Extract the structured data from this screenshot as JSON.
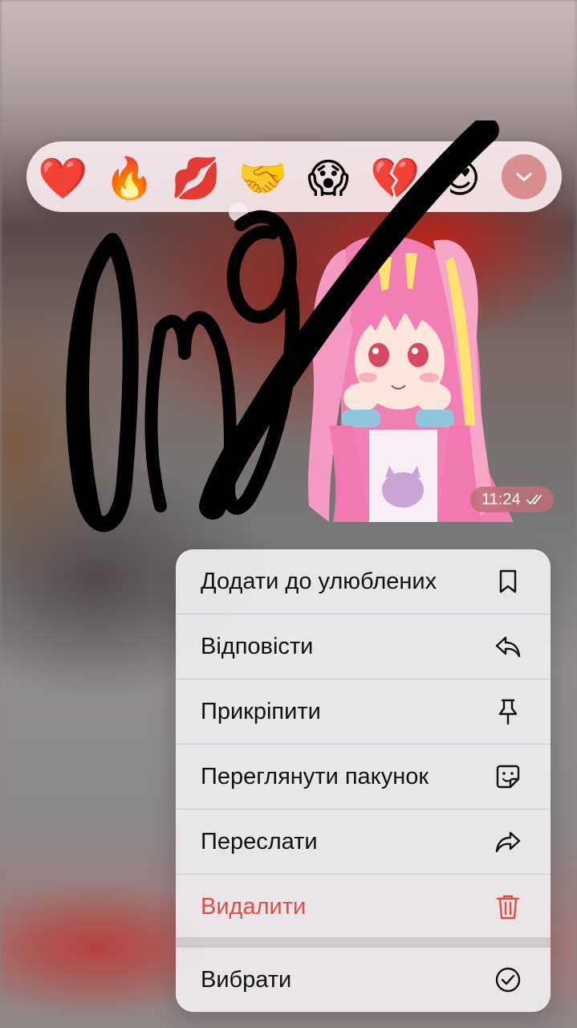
{
  "reactions": [
    {
      "emoji": "❤️",
      "name": "red-heart"
    },
    {
      "emoji": "🔥",
      "name": "fire"
    },
    {
      "emoji": "💋",
      "name": "kiss-mark"
    },
    {
      "emoji": "🤝",
      "name": "handshake"
    },
    {
      "emoji": "😱",
      "name": "scream"
    },
    {
      "emoji": "💔",
      "name": "broken-heart"
    },
    {
      "emoji": "😍",
      "name": "heart-eyes"
    }
  ],
  "message": {
    "time": "11:24",
    "status_icon": "double-check-icon"
  },
  "menu": {
    "items": [
      {
        "label": "Додати до улюблених",
        "icon": "bookmark-icon"
      },
      {
        "label": "Відповісти",
        "icon": "reply-icon"
      },
      {
        "label": "Прикріпити",
        "icon": "pin-icon"
      },
      {
        "label": "Переглянути пакунок",
        "icon": "sticker-pack-icon"
      },
      {
        "label": "Переслати",
        "icon": "forward-icon"
      },
      {
        "label": "Видалити",
        "icon": "trash-icon"
      },
      {
        "label": "Вибрати",
        "icon": "check-circle-icon"
      }
    ]
  },
  "colors": {
    "danger": "#e64c43",
    "reaction_bar": "#f8ecee",
    "expand_button": "#d88e8e"
  }
}
